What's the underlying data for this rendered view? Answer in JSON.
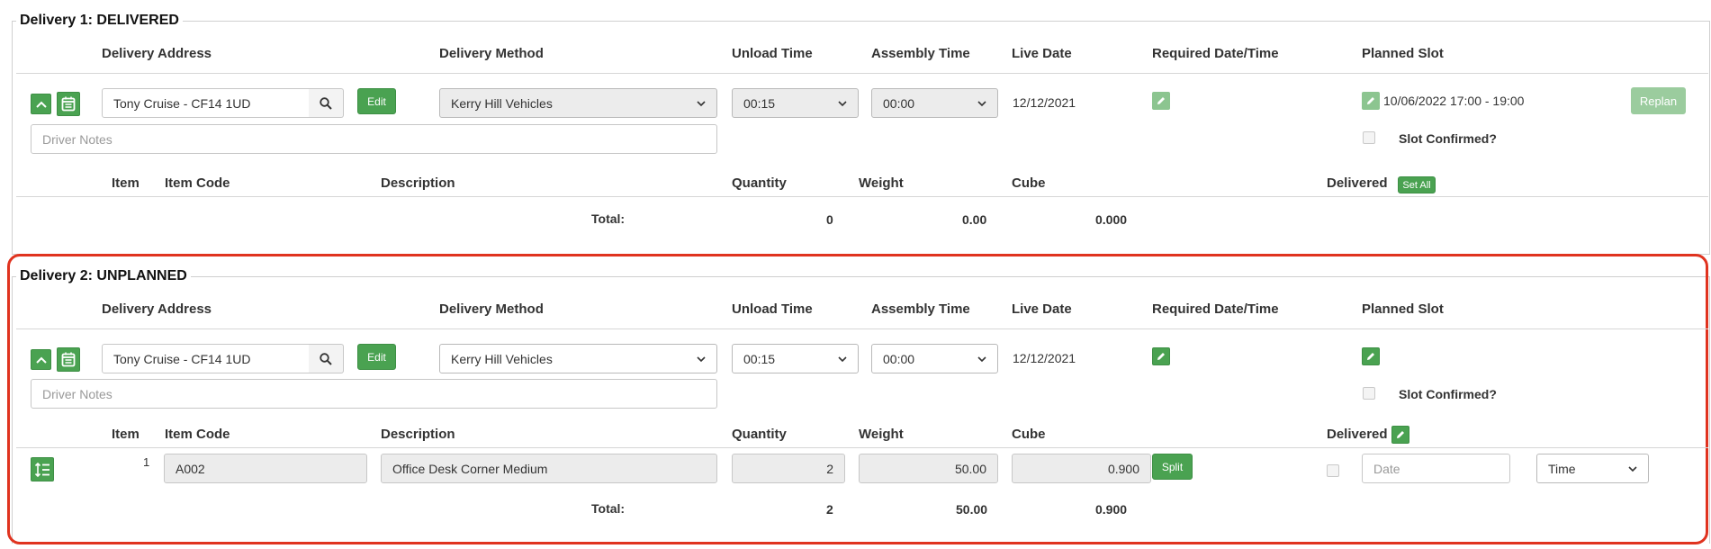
{
  "headers": {
    "delivery_address": "Delivery Address",
    "delivery_method": "Delivery Method",
    "unload_time": "Unload Time",
    "assembly_time": "Assembly Time",
    "live_date": "Live Date",
    "required_datetime": "Required Date/Time",
    "planned_slot": "Planned Slot",
    "item": "Item",
    "item_code": "Item Code",
    "description": "Description",
    "quantity": "Quantity",
    "weight": "Weight",
    "cube": "Cube",
    "delivered": "Delivered",
    "total": "Total:",
    "slot_confirmed": "Slot Confirmed?"
  },
  "buttons": {
    "edit": "Edit",
    "replan": "Replan",
    "set_all": "Set All",
    "split": "Split"
  },
  "placeholders": {
    "driver_notes": "Driver Notes",
    "date": "Date"
  },
  "delivery1": {
    "legend": "Delivery 1: DELIVERED",
    "address": "Tony Cruise - CF14 1UD",
    "method": "Kerry Hill Vehicles",
    "unload": "00:15",
    "assembly": "00:00",
    "live_date": "12/12/2021",
    "planned_slot": "10/06/2022 17:00 - 19:00",
    "totals": {
      "quantity": "0",
      "weight": "0.00",
      "cube": "0.000"
    }
  },
  "delivery2": {
    "legend": "Delivery 2: UNPLANNED",
    "address": "Tony Cruise - CF14 1UD",
    "method": "Kerry Hill Vehicles",
    "unload": "00:15",
    "assembly": "00:00",
    "live_date": "12/12/2021",
    "items": [
      {
        "item": "1",
        "code": "A002",
        "description": "Office Desk Corner Medium",
        "quantity": "2",
        "weight": "50.00",
        "cube": "0.900",
        "time": "Time"
      }
    ],
    "totals": {
      "quantity": "2",
      "weight": "50.00",
      "cube": "0.900"
    }
  },
  "colors": {
    "accent": "#4aa251",
    "highlight": "#e0331f"
  }
}
